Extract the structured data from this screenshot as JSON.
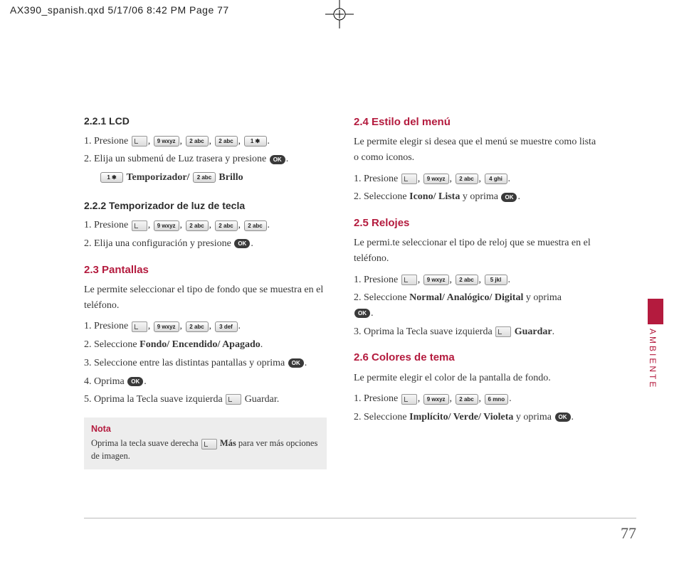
{
  "crop_header": "AX390_spanish.qxd  5/17/06  8:42 PM  Page 77",
  "side_label": "AMBIENTE",
  "page_number": "77",
  "keys": {
    "ok": "OK",
    "k1": "1 ✱",
    "k2": "2 abc",
    "k3": "3 def",
    "k4": "4 ghi",
    "k5": "5 jkl",
    "k6": "6 mno",
    "k9": "9 wxyz"
  },
  "left": {
    "h221": "2.2.1 LCD",
    "l221_1a": "1. Presione ",
    "l221_2a": "2. Elija un submenú de Luz trasera y presione ",
    "l221_opts_a": " Temporizador/ ",
    "l221_opts_b": " Brillo",
    "h222": "2.2.2 Temporizador de luz de tecla",
    "l222_1a": "1. Presione ",
    "l222_2a": "2. Elija una configuración y presione ",
    "h23": "2.3 Pantallas",
    "p23": "Le permite seleccionar el tipo de fondo que se muestra en el teléfono.",
    "l23_1a": "1. Presione ",
    "l23_2a": "2. Seleccione ",
    "l23_2b": "Fondo/ Encendido/ Apagado",
    "l23_3a": "3. Seleccione entre las distintas pantallas y oprima ",
    "l23_4a": "4. Oprima ",
    "l23_5a": "5. Oprima la Tecla suave izquierda ",
    "l23_5b": " Guardar.",
    "note_title": "Nota",
    "note_a": "Oprima la tecla suave derecha ",
    "note_b": " Más",
    "note_c": " para ver más opciones de imagen."
  },
  "right": {
    "h24": "2.4 Estilo del menú",
    "p24": "Le permite elegir si desea que el menú se muestre como lista o como iconos.",
    "l24_1a": "1. Presione ",
    "l24_2a": "2. Seleccione ",
    "l24_2b": "Icono/ Lista",
    "l24_2c": " y oprima ",
    "h25": "2.5 Relojes",
    "p25": "Le permi.te seleccionar el tipo de reloj que se muestra en el teléfono.",
    "l25_1a": "1. Presione ",
    "l25_2a": "2. Seleccione ",
    "l25_2b": "Normal/ Analógico/ Digital",
    "l25_2c": " y oprima ",
    "l25_3a": "3. Oprima la Tecla suave izquierda ",
    "l25_3b": " Guardar",
    "h26": "2.6 Colores de tema",
    "p26": "Le permite elegir el color de la pantalla de fondo.",
    "l26_1a": "1. Presione ",
    "l26_2a": "2. Seleccione ",
    "l26_2b": "Implícito/ Verde/ Violeta",
    "l26_2c": " y oprima "
  }
}
